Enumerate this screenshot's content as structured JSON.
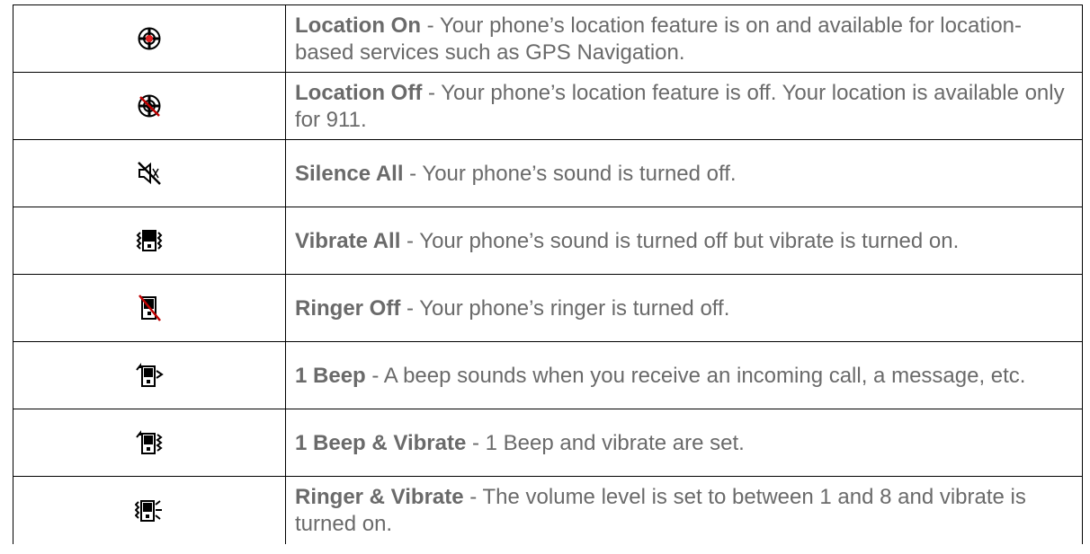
{
  "rows": [
    {
      "icon": "location-on-icon",
      "term": "Location On",
      "sep": " - ",
      "text": "Your phone’s location feature is on and available for location-based services such as GPS Navigation."
    },
    {
      "icon": "location-off-icon",
      "term": "Location Off",
      "sep": " - ",
      "text": "Your phone’s location feature is off. Your location is available only for 911."
    },
    {
      "icon": "silence-all-icon",
      "term": "Silence All",
      "sep": " - ",
      "text": "Your phone’s sound is turned off."
    },
    {
      "icon": "vibrate-all-icon",
      "term": "Vibrate All",
      "sep": " - ",
      "text": "Your phone’s sound is turned off but vibrate is turned on."
    },
    {
      "icon": "ringer-off-icon",
      "term": "Ringer Off",
      "sep": " - ",
      "text": "Your phone’s ringer is turned off."
    },
    {
      "icon": "one-beep-icon",
      "term": "1 Beep",
      "sep": " - ",
      "text": "A beep sounds when you receive an incoming call, a message, etc."
    },
    {
      "icon": "one-beep-vibrate-icon",
      "term": "1 Beep & Vibrate",
      "sep": " - ",
      "text": "1 Beep and vibrate are set."
    },
    {
      "icon": "ringer-vibrate-icon",
      "term": "Ringer & Vibrate",
      "sep": " - ",
      "text": "The volume level is set to between 1 and 8 and vibrate is turned on."
    }
  ],
  "colors": {
    "text": "#6a6a6a",
    "border": "#000000",
    "location_dot": "#e02020",
    "slash": "#c00000"
  }
}
